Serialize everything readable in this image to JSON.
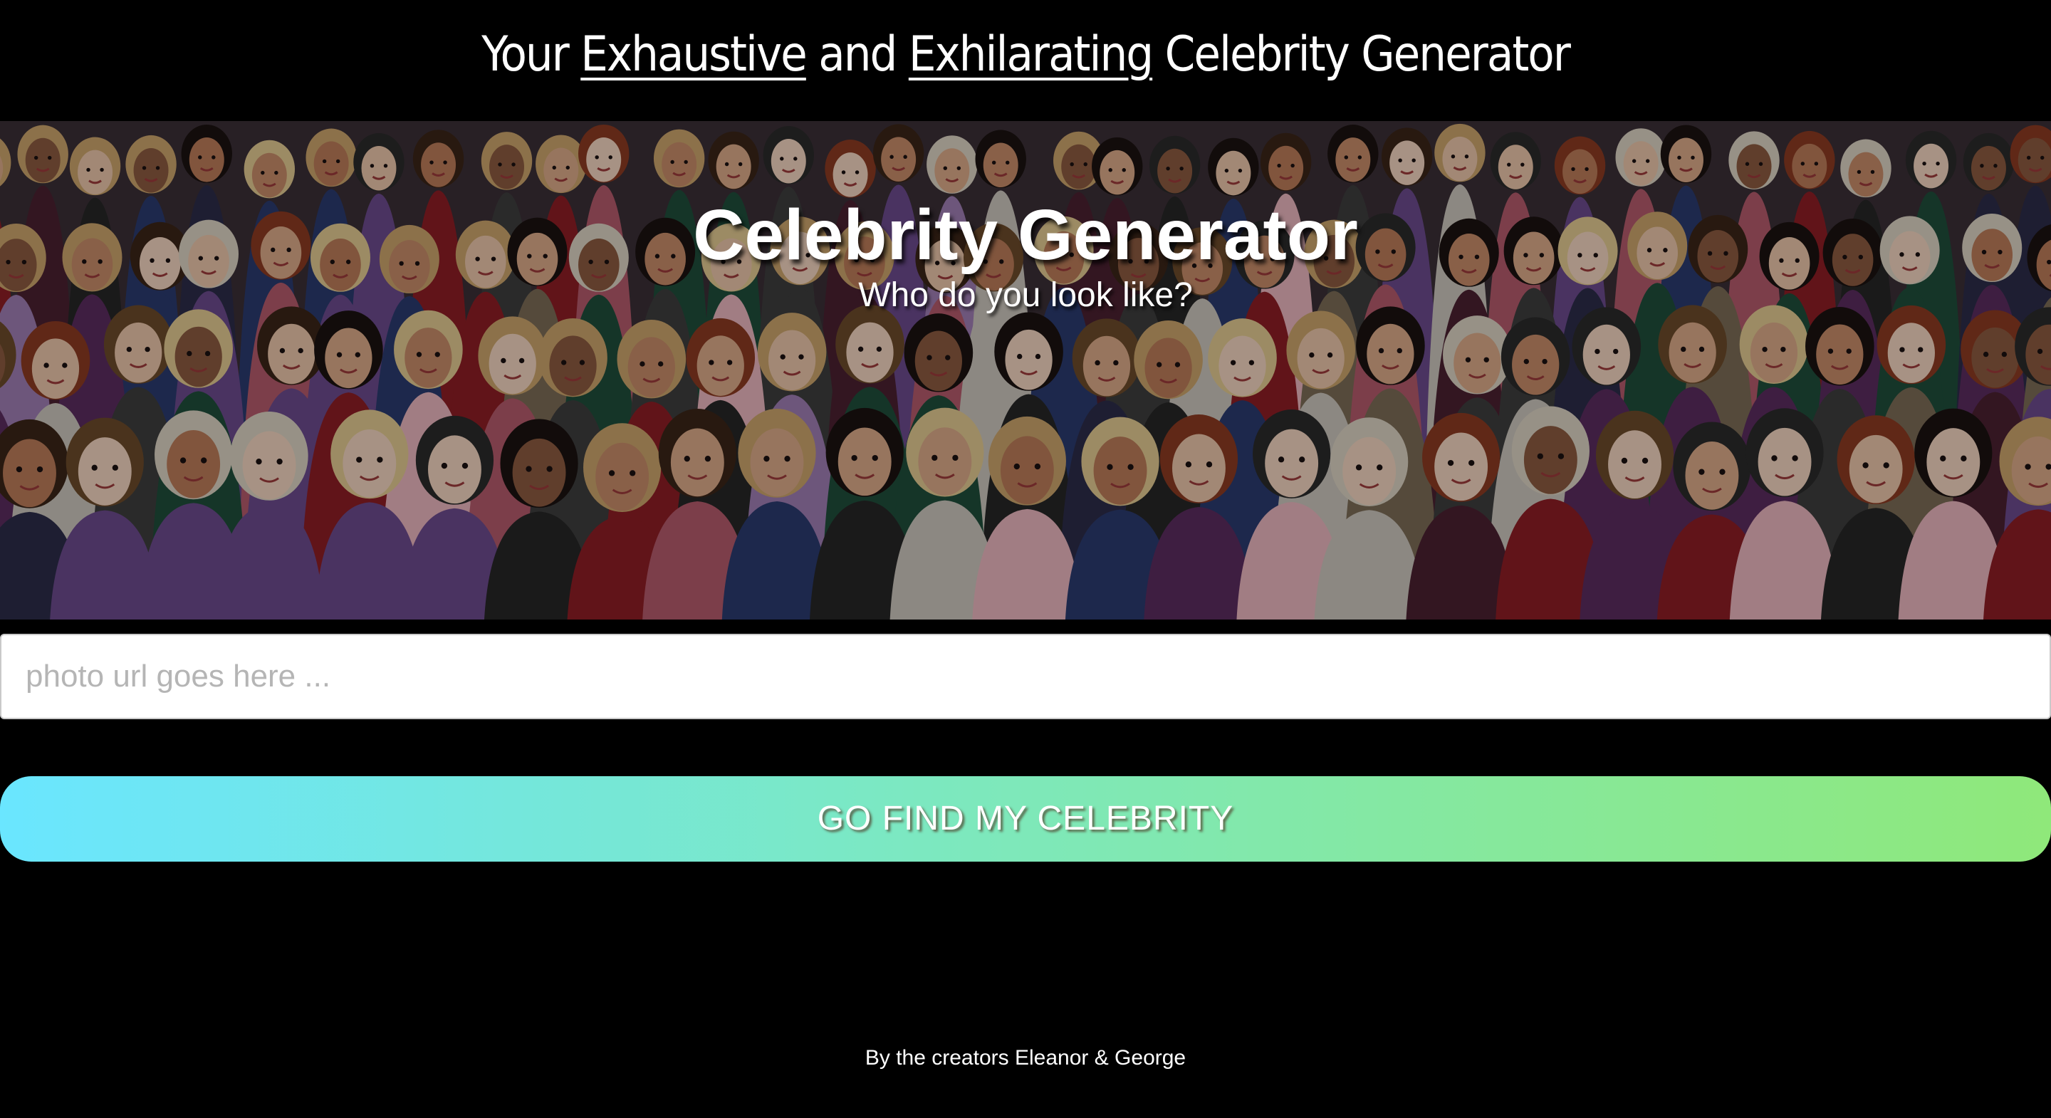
{
  "header": {
    "title_prefix": "Your",
    "title_word_1": "Exhaustive",
    "title_and": "and",
    "title_word_2": "Exhilarating",
    "title_suffix": "Celebrity Generator"
  },
  "hero": {
    "title": "Celebrity Generator",
    "subtitle": "Who do you look like?",
    "image_icon": "celebrity-crowd-illustration"
  },
  "form": {
    "url_placeholder": "photo url goes here ...",
    "url_value": "",
    "submit_label": "GO FIND MY CELEBRITY",
    "button_gradient": [
      "#6ae6ff",
      "#8fe87a"
    ]
  },
  "footer": {
    "credit": "By the creators Eleanor & George"
  },
  "colors": {
    "background": "#000000",
    "text": "#ffffff"
  }
}
